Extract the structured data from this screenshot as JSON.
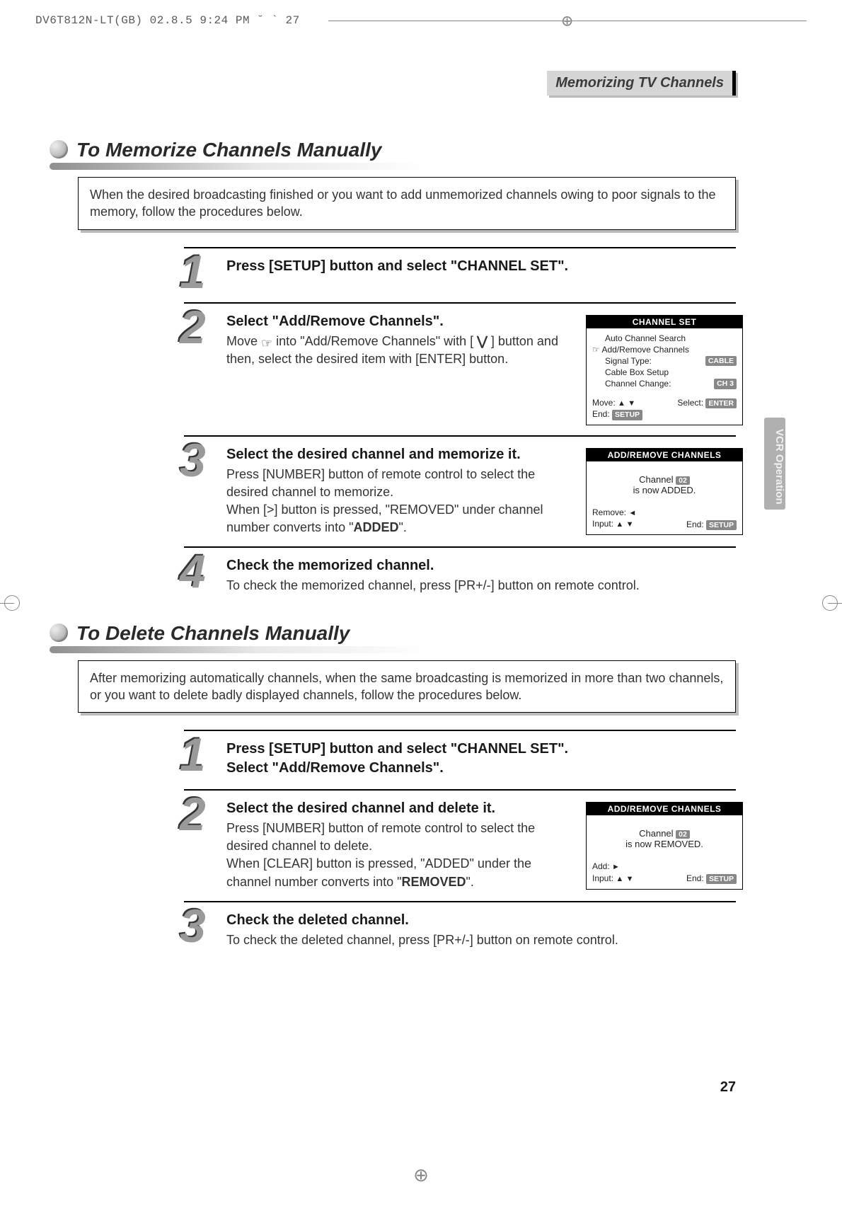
{
  "header": "DV6T812N-LT(GB)  02.8.5 9:24 PM  ˘  `  27",
  "chapter_tag": "Memorizing TV Channels",
  "side_tab": "VCR Operation",
  "page_number": "27",
  "memorize": {
    "title": "To Memorize Channels Manually",
    "intro": "When the desired broadcasting finished or you want to add unmemorized channels owing to poor signals to the memory, follow the procedures below.",
    "steps": [
      {
        "n": "1",
        "title": "Press [SETUP] button and select \"CHANNEL SET\".",
        "body": ""
      },
      {
        "n": "2",
        "title": "Select \"Add/Remove Channels\".",
        "body_pre": "Move ",
        "body_mid": " into \"Add/Remove Channels\" with [ ",
        "body_post": " ]  button and then, select the desired item with [ENTER] button.",
        "osd": {
          "title": "CHANNEL SET",
          "rows": [
            {
              "indent": true,
              "label": "Auto Channel Search",
              "val": ""
            },
            {
              "indent": false,
              "ptr": true,
              "label": "Add/Remove Channels",
              "val": ""
            },
            {
              "indent": true,
              "label": "Signal Type:",
              "val": "CABLE"
            },
            {
              "indent": true,
              "label": "Cable Box Setup",
              "val": ""
            },
            {
              "indent": true,
              "label": "Channel Change:",
              "val": "CH 3"
            }
          ],
          "foot_left1": "Move:",
          "foot_right1_label": "Select:",
          "foot_right1_pill": "ENTER",
          "foot_left2": "End:",
          "foot_left2_pill": "SETUP"
        }
      },
      {
        "n": "3",
        "title": "Select the desired channel and memorize it.",
        "body1": "Press [NUMBER] button of remote control to select the desired channel to memorize.",
        "body2_pre": "When [>] button is pressed, \"REMOVED\" under channel number converts into \"",
        "body2_bold": "ADDED",
        "body2_post": "\".",
        "osd": {
          "title": "ADD/REMOVE CHANNELS",
          "msg_line1a": "Channel ",
          "msg_line1_pill": "02",
          "msg_line2": "is now ADDED.",
          "foot_l1": "Remove:",
          "foot_l2": "Input:",
          "foot_r_label": "End:",
          "foot_r_pill": "SETUP"
        }
      },
      {
        "n": "4",
        "title": "Check the memorized channel.",
        "body": "To check the memorized channel, press [PR+/-] button on remote control."
      }
    ]
  },
  "delete": {
    "title": "To Delete Channels Manually",
    "intro": "After memorizing automatically channels, when the same broadcasting is memorized in more than two channels, or you want to delete badly displayed channels, follow the procedures below.",
    "steps": [
      {
        "n": "1",
        "title1": "Press [SETUP] button and select \"CHANNEL SET\".",
        "title2": "Select \"Add/Remove Channels\"."
      },
      {
        "n": "2",
        "title": "Select the desired channel and delete it.",
        "body1": "Press [NUMBER] button of remote control to select the desired channel to delete.",
        "body2_pre": "When [CLEAR] button is pressed, \"ADDED\" under the channel number converts into \"",
        "body2_bold": "REMOVED",
        "body2_post": "\".",
        "osd": {
          "title": "ADD/REMOVE CHANNELS",
          "msg_line1a": "Channel ",
          "msg_line1_pill": "02",
          "msg_line2": "is now REMOVED.",
          "foot_l1": "Add:",
          "foot_l2": "Input:",
          "foot_r_label": "End:",
          "foot_r_pill": "SETUP"
        }
      },
      {
        "n": "3",
        "title": "Check the deleted channel.",
        "body": "To check the deleted channel, press [PR+/-] button on remote control."
      }
    ]
  }
}
